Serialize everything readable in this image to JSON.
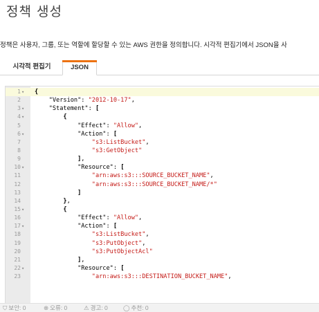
{
  "page": {
    "title": "정책 생성",
    "description": "정책은 사용자, 그룹, 또는 역할에 할당할 수 있는 AWS 권한을 정의합니다. 시각적 편집기에서 JSON을 사"
  },
  "tabs": [
    {
      "label": "시각적 편집기",
      "active": false
    },
    {
      "label": "JSON",
      "active": true
    }
  ],
  "editor": {
    "lines": [
      {
        "num": "1",
        "fold": true,
        "tokens": [
          {
            "t": "p",
            "v": "{"
          }
        ]
      },
      {
        "num": "2",
        "fold": false,
        "tokens": [
          {
            "t": "k",
            "v": "    \"Version\": "
          },
          {
            "t": "s",
            "v": "\"2012-10-17\""
          },
          {
            "t": "k",
            "v": ","
          }
        ]
      },
      {
        "num": "3",
        "fold": true,
        "tokens": [
          {
            "t": "k",
            "v": "    \"Statement\": "
          },
          {
            "t": "p",
            "v": "["
          }
        ]
      },
      {
        "num": "4",
        "fold": true,
        "tokens": [
          {
            "t": "p",
            "v": "        {"
          }
        ]
      },
      {
        "num": "5",
        "fold": false,
        "tokens": [
          {
            "t": "k",
            "v": "            \"Effect\": "
          },
          {
            "t": "s",
            "v": "\"Allow\""
          },
          {
            "t": "k",
            "v": ","
          }
        ]
      },
      {
        "num": "6",
        "fold": true,
        "tokens": [
          {
            "t": "k",
            "v": "            \"Action\": "
          },
          {
            "t": "p",
            "v": "["
          }
        ]
      },
      {
        "num": "7",
        "fold": false,
        "tokens": [
          {
            "t": "s",
            "v": "                \"s3:ListBucket\""
          },
          {
            "t": "k",
            "v": ","
          }
        ]
      },
      {
        "num": "8",
        "fold": false,
        "tokens": [
          {
            "t": "s",
            "v": "                \"s3:GetObject\""
          }
        ]
      },
      {
        "num": "9",
        "fold": false,
        "tokens": [
          {
            "t": "p",
            "v": "            ]"
          },
          {
            "t": "k",
            "v": ","
          }
        ]
      },
      {
        "num": "10",
        "fold": true,
        "tokens": [
          {
            "t": "k",
            "v": "            \"Resource\": "
          },
          {
            "t": "p",
            "v": "["
          }
        ]
      },
      {
        "num": "11",
        "fold": false,
        "tokens": [
          {
            "t": "s",
            "v": "                \"arn:aws:s3:::SOURCE_BUCKET_NAME\""
          },
          {
            "t": "k",
            "v": ","
          }
        ]
      },
      {
        "num": "12",
        "fold": false,
        "tokens": [
          {
            "t": "s",
            "v": "                \"arn:aws:s3:::SOURCE_BUCKET_NAME/*\""
          }
        ]
      },
      {
        "num": "13",
        "fold": false,
        "tokens": [
          {
            "t": "p",
            "v": "            ]"
          }
        ]
      },
      {
        "num": "14",
        "fold": false,
        "tokens": [
          {
            "t": "p",
            "v": "        }"
          },
          {
            "t": "k",
            "v": ","
          }
        ]
      },
      {
        "num": "15",
        "fold": true,
        "tokens": [
          {
            "t": "p",
            "v": "        {"
          }
        ]
      },
      {
        "num": "16",
        "fold": false,
        "tokens": [
          {
            "t": "k",
            "v": "            \"Effect\": "
          },
          {
            "t": "s",
            "v": "\"Allow\""
          },
          {
            "t": "k",
            "v": ","
          }
        ]
      },
      {
        "num": "17",
        "fold": true,
        "tokens": [
          {
            "t": "k",
            "v": "            \"Action\": "
          },
          {
            "t": "p",
            "v": "["
          }
        ]
      },
      {
        "num": "18",
        "fold": false,
        "tokens": [
          {
            "t": "s",
            "v": "                \"s3:ListBucket\""
          },
          {
            "t": "k",
            "v": ","
          }
        ]
      },
      {
        "num": "19",
        "fold": false,
        "tokens": [
          {
            "t": "s",
            "v": "                \"s3:PutObject\""
          },
          {
            "t": "k",
            "v": ","
          }
        ]
      },
      {
        "num": "20",
        "fold": false,
        "tokens": [
          {
            "t": "s",
            "v": "                \"s3:PutObjectAcl\""
          }
        ]
      },
      {
        "num": "21",
        "fold": false,
        "tokens": [
          {
            "t": "p",
            "v": "            ]"
          },
          {
            "t": "k",
            "v": ","
          }
        ]
      },
      {
        "num": "22",
        "fold": true,
        "tokens": [
          {
            "t": "k",
            "v": "            \"Resource\": "
          },
          {
            "t": "p",
            "v": "["
          }
        ]
      },
      {
        "num": "23",
        "fold": false,
        "tokens": [
          {
            "t": "s",
            "v": "                \"arn:aws:s3:::DESTINATION_BUCKET_NAME\""
          },
          {
            "t": "k",
            "v": ","
          }
        ]
      }
    ]
  },
  "statusbar": {
    "security_label": "보안: 0",
    "error_label": "오류: 0",
    "warning_label": "경고: 0",
    "suggestion_label": "추천: 0"
  },
  "colors": {
    "accent": "#ec7211",
    "string": "#c41a16",
    "gutter": "#ebebeb"
  }
}
